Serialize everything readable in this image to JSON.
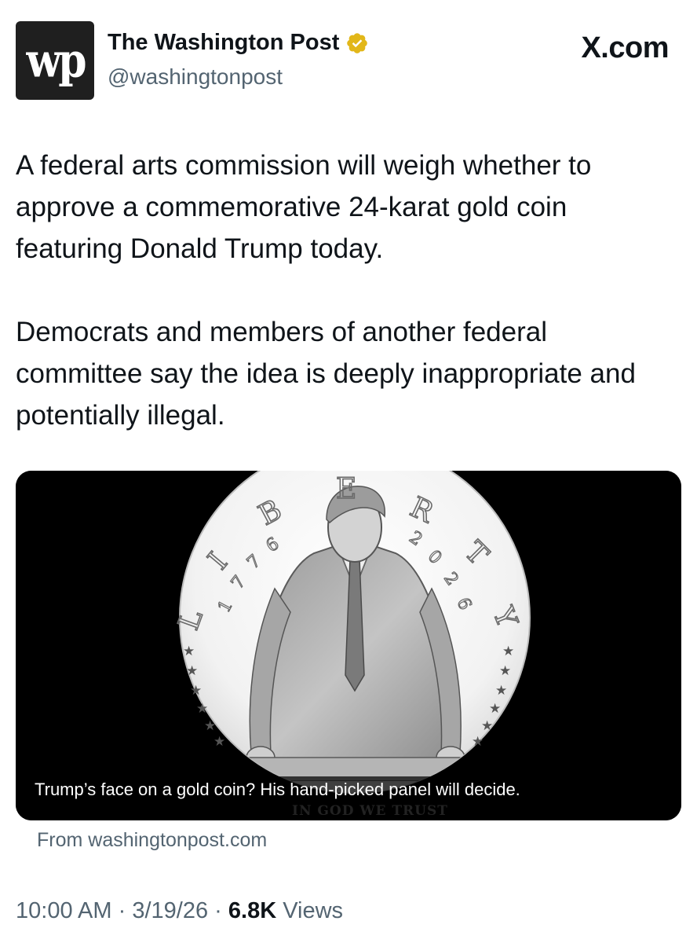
{
  "account": {
    "display_name": "The Washington Post",
    "handle": "@washingtonpost",
    "avatar_icon": "washington-post-wp-logo",
    "verified_icon": "gold-verified-badge-icon",
    "verified_color": "#e2b719"
  },
  "site_label": "X.com",
  "tweet": {
    "paragraph_1": "A federal arts commission will weigh whether to approve a commemorative 24-karat gold coin featuring Donald Trump today.",
    "paragraph_2": "Democrats and members of another federal committee say the idea is deeply inappropriate and potentially illegal."
  },
  "link_card": {
    "image_icon": "coin-design-illustration",
    "coin_text": {
      "liberty": "LIBERTY",
      "year_left": "1776",
      "year_right": "2026",
      "motto": "IN GOD WE TRUST"
    },
    "caption": "Trump’s face on a gold coin? His hand-picked panel will decide.",
    "source": "From washingtonpost.com"
  },
  "meta": {
    "time": "10:00 AM",
    "separator": "·",
    "date": "3/19/26",
    "views_count": "6.8K",
    "views_label": "Views"
  },
  "colors": {
    "text_primary": "#0f1419",
    "text_secondary": "#536471",
    "card_background": "#000000"
  }
}
